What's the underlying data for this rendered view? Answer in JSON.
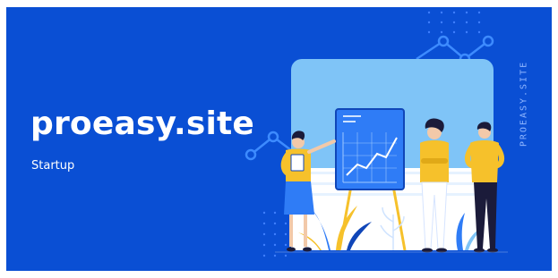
{
  "banner": {
    "site_name": "proeasy.site",
    "tagline": "Startup",
    "vertical_label": "PROEASY.SITE"
  },
  "colors": {
    "background": "#0a4fd4",
    "panel": "#7fc4f7",
    "accent_yellow": "#f6c12b",
    "line_blue": "#3d8bff",
    "white": "#ffffff"
  },
  "illustration": {
    "people_count": 3,
    "icons": [
      "line-chart-board",
      "trend-line",
      "plant",
      "person"
    ]
  }
}
